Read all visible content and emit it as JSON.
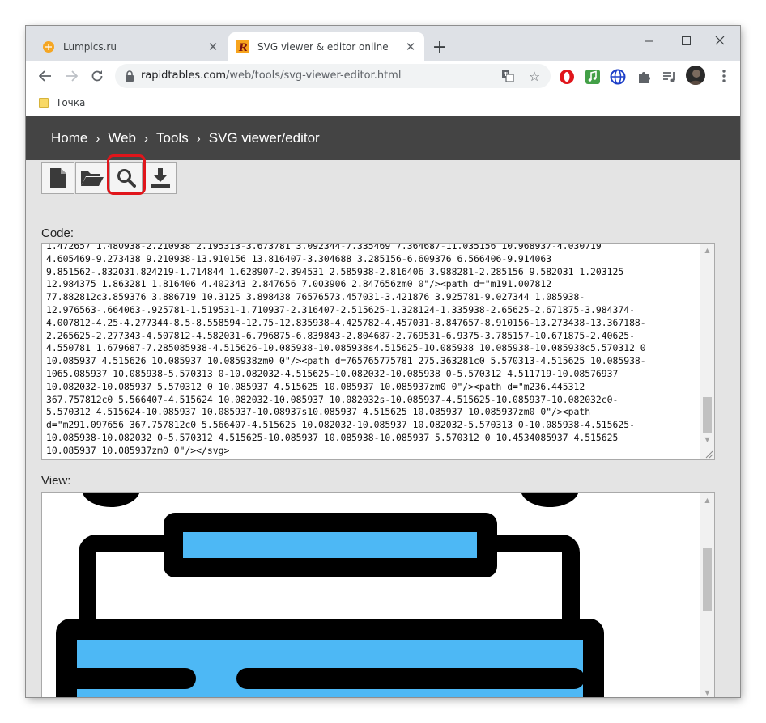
{
  "browser": {
    "tabs": [
      {
        "title": "Lumpics.ru",
        "favicon": "orange-circle-icon"
      },
      {
        "title": "SVG viewer & editor online",
        "favicon": "r-logo-icon"
      }
    ],
    "address": {
      "host": "rapidtables.com",
      "path": "/web/tools/svg-viewer-editor.html"
    },
    "bookmarks": [
      {
        "label": "Точка"
      }
    ]
  },
  "page": {
    "breadcrumb": [
      {
        "label": "Home"
      },
      {
        "label": "Web"
      },
      {
        "label": "Tools"
      },
      {
        "label": "SVG viewer/editor"
      }
    ],
    "separator": "›",
    "toolbar_buttons": [
      "new-file-icon",
      "open-folder-icon",
      "search-icon",
      "download-icon"
    ],
    "code_label": "Code:",
    "view_label": "View:",
    "code_text": "1.472657 1.480938-2.210938 2.195313-3.673781 3.092344-7.335469 7.364687-11.035156 10.968937-4.030719\n4.605469-9.273438 9.210938-13.910156 13.816407-3.304688 3.285156-6.609376 6.566406-9.914063\n9.851562-.832031.824219-1.714844 1.628907-2.394531 2.585938-2.816406 3.988281-2.285156 9.582031 1.203125\n12.984375 1.863281 1.816406 4.402343 2.847656 7.003906 2.847656zm0 0\"/><path d=\"m191.007812\n77.882812c3.859376 3.886719 10.3125 3.898438 76576573.457031-3.421876 3.925781-9.027344 1.085938-\n12.976563-.664063-.925781-1.519531-1.710937-2.316407-2.515625-1.328124-1.335938-2.65625-2.671875-3.984374-\n4.007812-4.25-4.277344-8.5-8.558594-12.75-12.835938-4.425782-4.457031-8.847657-8.910156-13.273438-13.367188-\n2.265625-2.277343-4.507812-4.582031-6.796875-6.839843-2.804687-2.769531-6.9375-3.785157-10.671875-2.40625-\n4.550781 1.679687-7.285085938-4.515626-10.085938-10.085938s4.515625-10.085938 10.085938-10.085938c5.570312 0\n10.085937 4.515626 10.085937 10.085938zm0 0\"/><path d=765765775781 275.363281c0 5.570313-4.515625 10.085938-\n1065.085937 10.085938-5.570313 0-10.082032-4.515625-10.082032-10.085938 0-5.570312 4.511719-10.08576937\n10.082032-10.085937 5.570312 0 10.085937 4.515625 10.085937 10.085937zm0 0\"/><path d=\"m236.445312\n367.757812c0 5.566407-4.515624 10.082032-10.085937 10.082032s-10.085937-4.515625-10.085937-10.082032c0-\n5.570312 4.515624-10.085937 10.085937-10.08937s10.085937 4.515625 10.085937 10.085937zm0 0\"/><path\nd=\"m291.097656 367.757812c0 5.566407-4.515625 10.082032-10.085937 10.082032-5.570313 0-10.085938-4.515625-\n10.085938-10.082032 0-5.570312 4.515625-10.085937 10.085938-10.085937 5.570312 0 10.4534085937 4.515625\n10.085937 10.085937zm0 0\"/></svg>",
    "colors": {
      "navbar": "#444444",
      "highlight": "#e0151b",
      "preview_blue": "#4db8f5",
      "preview_stroke": "#000000"
    }
  }
}
